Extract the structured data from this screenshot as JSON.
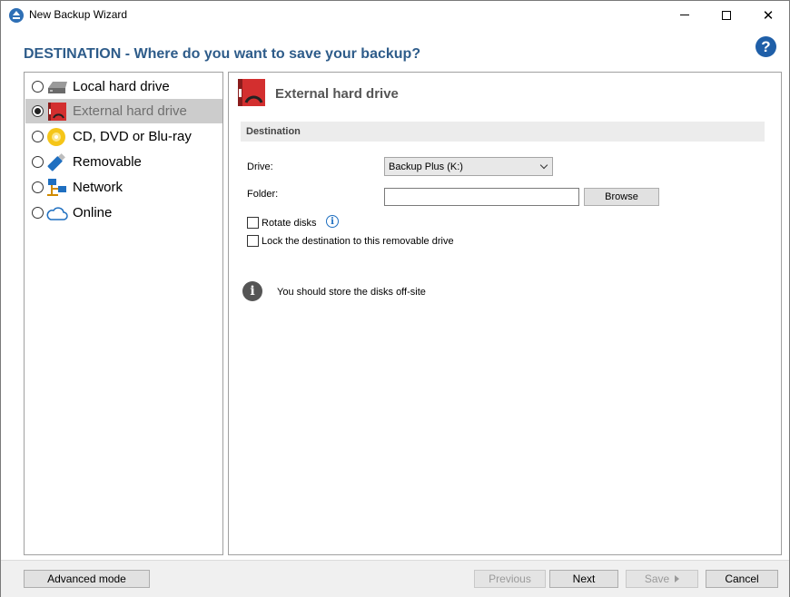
{
  "window": {
    "title": "New Backup Wizard"
  },
  "header": {
    "title": "DESTINATION - Where do you want to save your backup?",
    "help_glyph": "?"
  },
  "destinations": [
    {
      "label": "Local hard drive",
      "icon": "local-drive-icon",
      "selected": false
    },
    {
      "label": "External hard drive",
      "icon": "external-drive-icon",
      "selected": true
    },
    {
      "label": "CD, DVD or Blu-ray",
      "icon": "disc-icon",
      "selected": false
    },
    {
      "label": "Removable",
      "icon": "usb-icon",
      "selected": false
    },
    {
      "label": "Network",
      "icon": "network-icon",
      "selected": false
    },
    {
      "label": "Online",
      "icon": "cloud-icon",
      "selected": false
    }
  ],
  "panel": {
    "title": "External hard drive",
    "section": "Destination",
    "drive_label": "Drive:",
    "drive_value": "Backup Plus (K:)",
    "folder_label": "Folder:",
    "folder_value": "",
    "browse_label": "Browse",
    "rotate_label": "Rotate disks",
    "rotate_checked": false,
    "lock_label": "Lock the destination to this removable drive",
    "lock_checked": false,
    "info_text": "You should store the disks off-site"
  },
  "footer": {
    "advanced_label": "Advanced mode",
    "previous_label": "Previous",
    "next_label": "Next",
    "save_label": "Save",
    "cancel_label": "Cancel"
  },
  "colors": {
    "accent": "#2e5c8a",
    "selection": "#cccccc",
    "drive_red": "#d32f2f"
  }
}
